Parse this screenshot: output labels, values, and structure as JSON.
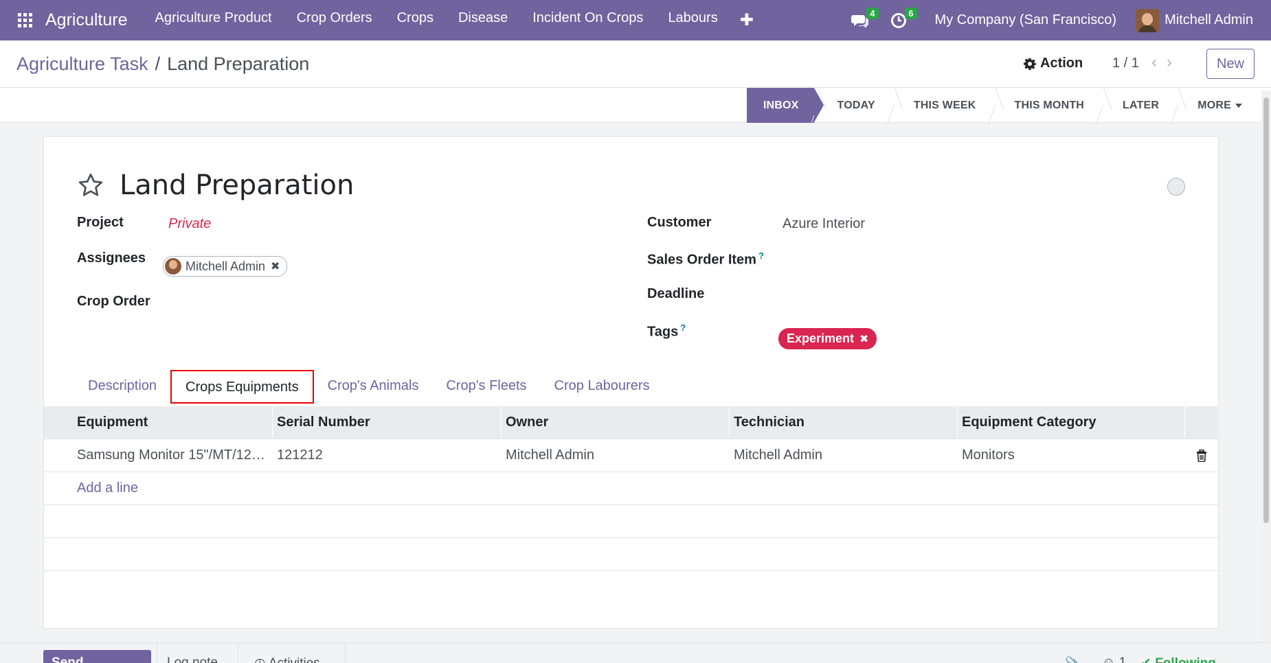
{
  "navbar": {
    "brand": "Agriculture",
    "menu": [
      "Agriculture Product",
      "Crop Orders",
      "Crops",
      "Disease",
      "Incident On Crops",
      "Labours"
    ],
    "plus": "✚",
    "messages_count": "4",
    "activities_count": "6",
    "company": "My Company (San Francisco)",
    "user": "Mitchell Admin"
  },
  "control_panel": {
    "breadcrumb_parent": "Agriculture Task",
    "breadcrumb_sep": "/",
    "breadcrumb_current": "Land Preparation",
    "action_label": "Action",
    "pager": "1 / 1",
    "new_label": "New"
  },
  "stages": {
    "inbox": "INBOX",
    "today": "TODAY",
    "this_week": "THIS WEEK",
    "this_month": "THIS MONTH",
    "later": "LATER",
    "more": "MORE"
  },
  "form": {
    "title": "Land Preparation",
    "project_label": "Project",
    "project_value": "Private",
    "assignees_label": "Assignees",
    "assignee": "Mitchell Admin",
    "crop_order_label": "Crop Order",
    "customer_label": "Customer",
    "customer_value": "Azure Interior",
    "sales_order_item_label": "Sales Order Item",
    "deadline_label": "Deadline",
    "tags_label": "Tags",
    "tag": "Experiment",
    "help_mark": "?"
  },
  "tabs": {
    "description": "Description",
    "crops_equipments": "Crops Equipments",
    "animals": "Crop's Animals",
    "fleets": "Crop's Fleets",
    "labourers": "Crop Labourers"
  },
  "table": {
    "headers": {
      "equipment": "Equipment",
      "serial": "Serial Number",
      "owner": "Owner",
      "technician": "Technician",
      "category": "Equipment Category"
    },
    "rows": [
      {
        "equipment": "Samsung Monitor 15\"/MT/12…",
        "serial": "121212",
        "owner": "Mitchell Admin",
        "technician": "Mitchell Admin",
        "category": "Monitors"
      }
    ],
    "add_line": "Add a line"
  },
  "chatter": {
    "send_message": "Send message",
    "log_note": "Log note",
    "activities": "Activities",
    "followers_count": "1",
    "following": "Following"
  },
  "colors": {
    "brand": "#71639e",
    "tag": "#d9254f",
    "badge": "#28a745"
  }
}
